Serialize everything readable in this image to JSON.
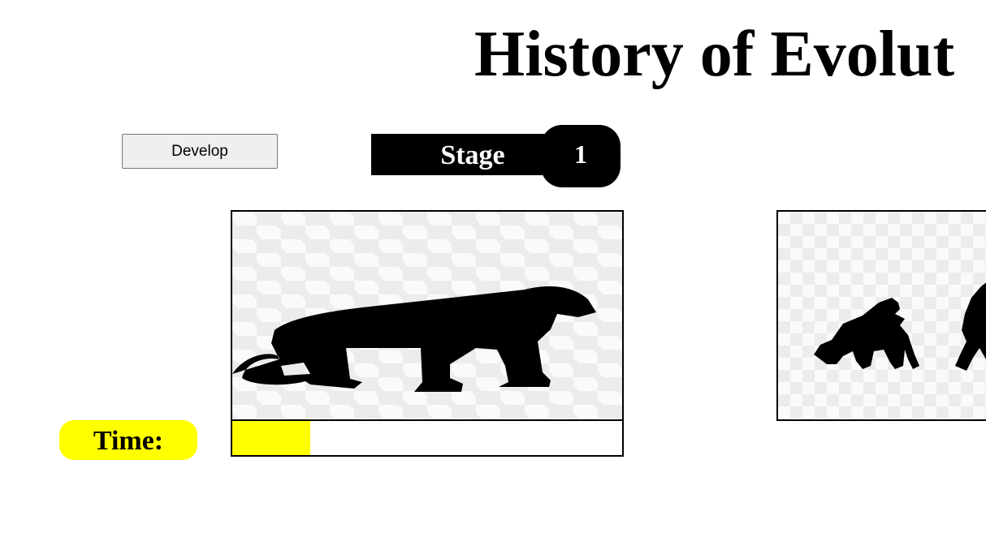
{
  "header": {
    "title": "History of Evolut"
  },
  "controls": {
    "develop_label": "Develop"
  },
  "stage": {
    "label": "Stage",
    "value": "1"
  },
  "time": {
    "label": "Time:",
    "progress_fraction": 0.2
  },
  "images": {
    "current": "monkey-silhouette",
    "next": "evolution-silhouettes"
  },
  "colors": {
    "timer_accent": "#ffff00",
    "stage_bg": "#000000",
    "stage_text": "#ffffff"
  }
}
